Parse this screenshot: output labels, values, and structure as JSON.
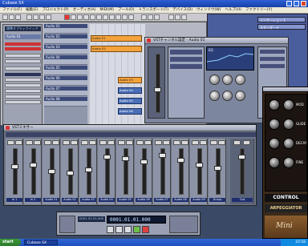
{
  "app_title": "Cubase SX",
  "menu": [
    "ファイル(F)",
    "編集(E)",
    "プロジェクト(P)",
    "オーディオ(A)",
    "MIDI(M)",
    "プール(O)",
    "トランスポート(T)",
    "デバイス(D)",
    "ウィンドウ(W)",
    "ヘルプ(H)",
    "ファクトリー(Y)"
  ],
  "inspector": {
    "preset": "標準オプティクイック",
    "track_label": "Audio 01"
  },
  "tracks": [
    {
      "name": "Audio 01"
    },
    {
      "name": "Audio 02"
    },
    {
      "name": "Audio 03"
    },
    {
      "name": "Audio 04"
    },
    {
      "name": "Audio 05"
    },
    {
      "name": "Audio 06"
    },
    {
      "name": "Audio 07"
    },
    {
      "name": "Audio 08"
    }
  ],
  "parts": {
    "orange": [
      "Audio 01",
      "Audio 02",
      "Audio 03"
    ],
    "blue": [
      "Audio 04",
      "Audio 05",
      "Audio 06"
    ]
  },
  "channel_settings": {
    "title": "VSTチャンネル設定 - Audio 01",
    "eq_label": "EQ"
  },
  "right_panel": {
    "line1": "インサーション 1",
    "line2": "スタンダード"
  },
  "synth": {
    "control_label": "CONTROL",
    "arp_label": "ARPEGGIATOR",
    "mini_label": "Mini",
    "knob_labels": [
      "MOD",
      "GLIDE",
      "DECAY",
      "FINE"
    ]
  },
  "mixer": {
    "title": "VSTミキサー",
    "channels": [
      "In 1",
      "In 2",
      "Audio 01",
      "Audio 02",
      "Audio 03",
      "Audio 04",
      "Audio 05",
      "Audio 06",
      "Audio 07",
      "Audio 08",
      "Audio 09",
      "Group",
      "Out"
    ]
  },
  "transport": {
    "time_display": "0001.01.01.000",
    "secondary": "0001.01.01.000"
  },
  "taskbar": {
    "start": "start",
    "app_button": "Cubase SX",
    "clock": "10:58"
  }
}
